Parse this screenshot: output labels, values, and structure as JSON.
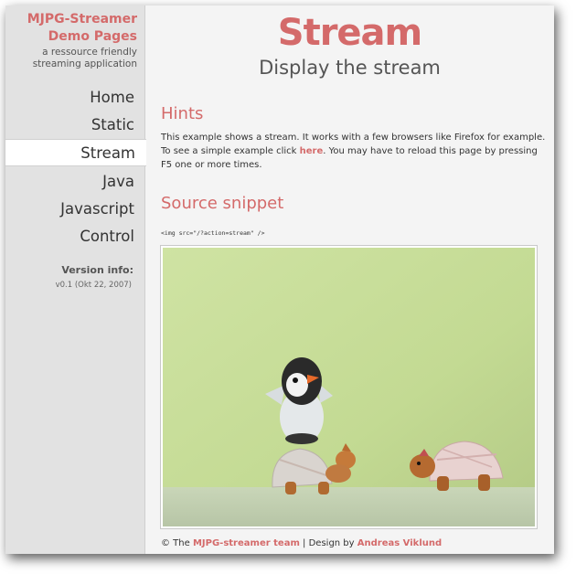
{
  "sidebar": {
    "logo_title_line1": "MJPG-Streamer",
    "logo_title_line2": "Demo Pages",
    "logo_sub_line1": "a ressource friendly",
    "logo_sub_line2": "streaming application",
    "nav": [
      {
        "label": "Home"
      },
      {
        "label": "Static"
      },
      {
        "label": "Stream",
        "active": true
      },
      {
        "label": "Java"
      },
      {
        "label": "Javascript"
      },
      {
        "label": "Control"
      }
    ],
    "version_title": "Version info:",
    "version_text": "v0.1 (Okt 22, 2007)"
  },
  "main": {
    "title": "Stream",
    "subtitle": "Display the stream",
    "hints_heading": "Hints",
    "hints_text_1": "This example shows a stream. It works with a few browsers like Firefox for example. To see a simple example click ",
    "hints_link": "here",
    "hints_text_2": ". You may have to reload this page by pressing F5 one or more times.",
    "snippet_heading": "Source snippet",
    "code_snippet": "<img src=\"/?action=stream\" />",
    "footer_prefix": "© The ",
    "footer_team": "MJPG-streamer team",
    "footer_mid": " | Design by ",
    "footer_author": "Andreas Viklund"
  },
  "colors": {
    "accent": "#d46a6a",
    "sidebar_bg": "#e2e2e2",
    "page_bg": "#f4f4f4",
    "stream_wall": "#c6dc96"
  }
}
